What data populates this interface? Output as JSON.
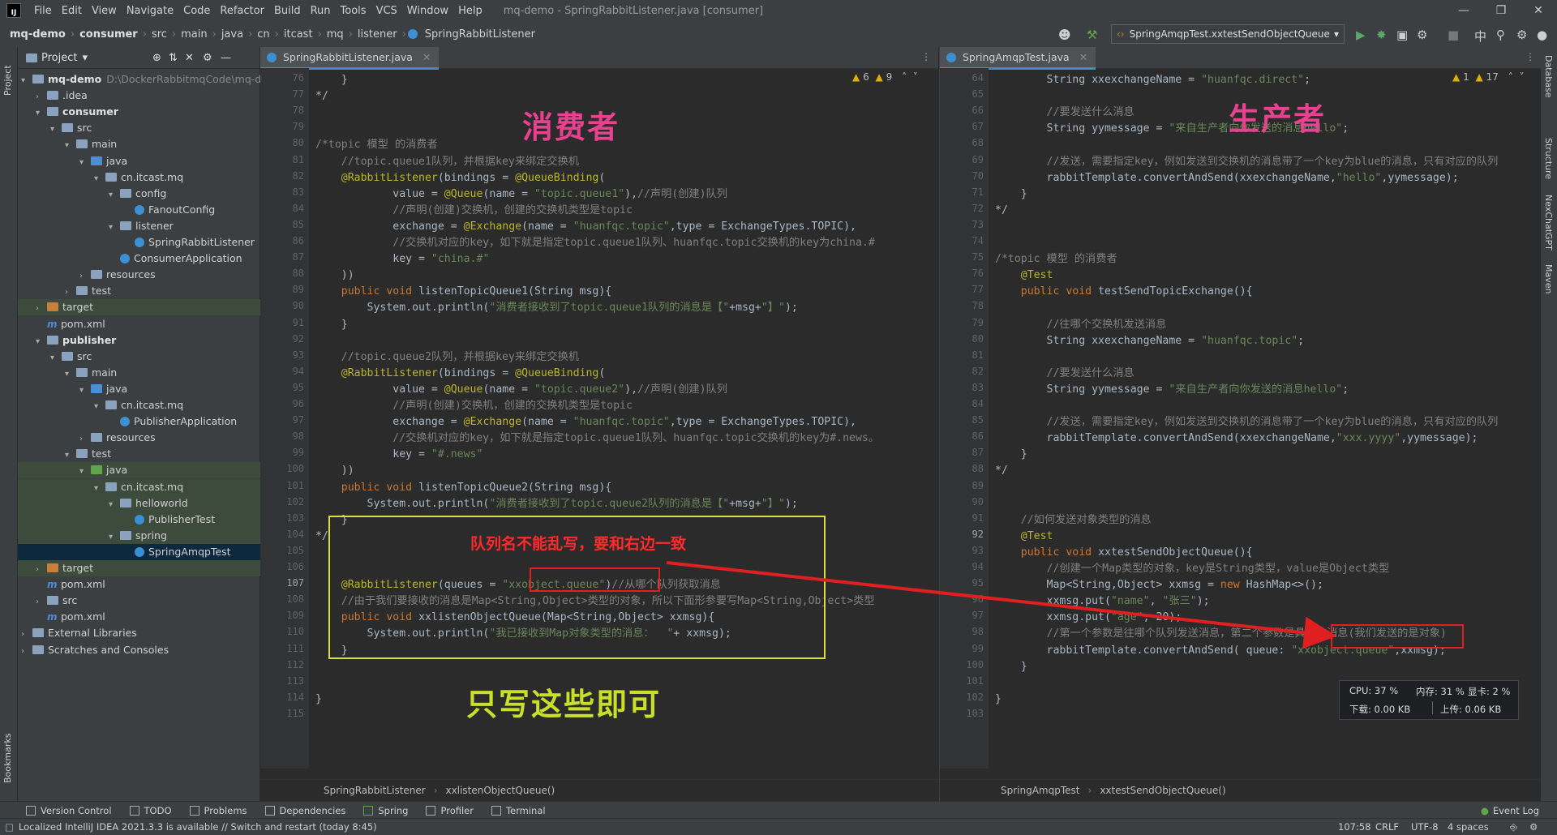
{
  "menubar": {
    "items": [
      "File",
      "Edit",
      "View",
      "Navigate",
      "Code",
      "Refactor",
      "Build",
      "Run",
      "Tools",
      "VCS",
      "Window",
      "Help"
    ],
    "title": "mq-demo - SpringRabbitListener.java [consumer]"
  },
  "navbar": {
    "crumbs": [
      "mq-demo",
      "consumer",
      "src",
      "main",
      "java",
      "cn",
      "itcast",
      "mq",
      "listener",
      "SpringRabbitListener"
    ],
    "run_config": "SpringAmqpTest.xxtestSendObjectQueue"
  },
  "project": {
    "title": "Project",
    "root_label": "mq-demo",
    "root_path": "D:\\DockerRabbitmqCode\\mq-de",
    "tree": [
      ".idea",
      "consumer",
      "src",
      "main",
      "java",
      "cn.itcast.mq",
      "config",
      "FanoutConfig",
      "listener",
      "SpringRabbitListener",
      "ConsumerApplication",
      "resources",
      "test",
      "target",
      "pom.xml",
      "publisher",
      "src",
      "main",
      "java",
      "cn.itcast.mq",
      "PublisherApplication",
      "resources",
      "test",
      "java",
      "cn.itcast.mq",
      "helloworld",
      "PublisherTest",
      "spring",
      "SpringAmqpTest",
      "target",
      "pom.xml",
      "src",
      "pom.xml",
      "External Libraries",
      "Scratches and Consoles"
    ]
  },
  "left_editor": {
    "tab": "SpringRabbitListener.java",
    "warnings": "6",
    "weak_warnings": "9",
    "line_numbers": [
      "76",
      "77",
      "78",
      "79",
      "80",
      "81",
      "82",
      "83",
      "84",
      "85",
      "86",
      "87",
      "88",
      "89",
      "90",
      "91",
      "92",
      "93",
      "94",
      "95",
      "96",
      "97",
      "98",
      "99",
      "100",
      "101",
      "102",
      "103",
      "104",
      "105",
      "106",
      "107",
      "108",
      "109",
      "110",
      "111",
      "112",
      "113",
      "114",
      "115"
    ],
    "breadcrumb": [
      "SpringRabbitListener",
      "xxlistenObjectQueue()"
    ]
  },
  "right_editor": {
    "tab": "SpringAmqpTest.java",
    "warnings": "1",
    "weak_warnings": "17",
    "line_numbers": [
      "64",
      "65",
      "66",
      "67",
      "68",
      "69",
      "70",
      "71",
      "72",
      "73",
      "74",
      "75",
      "76",
      "77",
      "78",
      "79",
      "80",
      "81",
      "82",
      "83",
      "84",
      "85",
      "86",
      "87",
      "88",
      "89",
      "90",
      "91",
      "92",
      "93",
      "94",
      "95",
      "96",
      "97",
      "98",
      "99",
      "100",
      "101",
      "102",
      "103"
    ],
    "breadcrumb": [
      "SpringAmqpTest",
      "xxtestSendObjectQueue()"
    ]
  },
  "annotations": {
    "consumer": "消费者",
    "producer": "生产者",
    "queue_note": "队列名不能乱写，要和右边一致",
    "only_this": "只写这些即可"
  },
  "perf_monitor": {
    "cpu": "CPU: 37 %",
    "mem": "内存: 31 %",
    "gpu": "显卡: 2 %",
    "down": "下载: 0.00 KB",
    "up": "上传: 0.06 KB"
  },
  "right_strip": [
    "Database",
    "Structure",
    "NexChatGPT",
    "Maven"
  ],
  "left_strip": [
    "Project",
    "Bookmarks"
  ],
  "tool_windows": [
    "Version Control",
    "TODO",
    "Problems",
    "Dependencies",
    "Spring",
    "Profiler",
    "Terminal"
  ],
  "event_log": "Event Log",
  "status": {
    "message": "Localized IntelliJ IDEA 2021.3.3 is available // Switch and restart (today 8:45)",
    "position": "107:58",
    "line_sep": "CRLF",
    "encoding": "UTF-8",
    "indent": "4 spaces"
  },
  "colors": {
    "accent": "#4a88c7",
    "consumer_text": "#e8418f",
    "producer_text": "#e8418f",
    "box_yellow": "#d4e23a",
    "box_red": "#e02020",
    "note_red": "#ff2a2a",
    "only_green": "#c8e02a"
  }
}
